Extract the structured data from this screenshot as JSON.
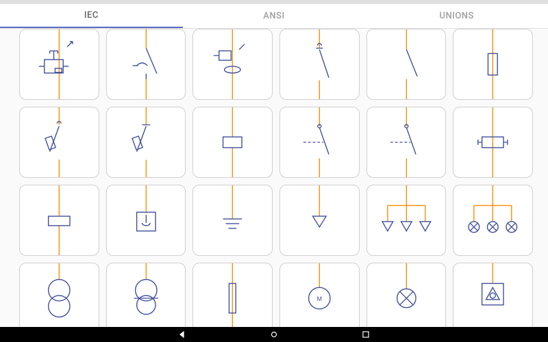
{
  "tabs": [
    {
      "label": "IEC",
      "active": true
    },
    {
      "label": "ANSI",
      "active": false
    },
    {
      "label": "UNIONS",
      "active": false
    }
  ],
  "symbols": {
    "r1": [
      {
        "name": "circuit-breaker-with-protection",
        "icon": "cb-protection"
      },
      {
        "name": "disconnector-switch-manual",
        "icon": "disc-manual"
      },
      {
        "name": "circuit-breaker-with-sensor",
        "icon": "cb-sensor"
      },
      {
        "name": "disconnector-switch",
        "icon": "disc"
      },
      {
        "name": "switch-break",
        "icon": "switch-break"
      },
      {
        "name": "fuse-rect",
        "icon": "fuse-rect"
      }
    ],
    "r2": [
      {
        "name": "fuse-switch-left",
        "icon": "fuse-switch-l"
      },
      {
        "name": "fuse-switch-right",
        "icon": "fuse-switch-r"
      },
      {
        "name": "inline-box",
        "icon": "inline-box"
      },
      {
        "name": "isolator-dashed",
        "icon": "isolator-dash"
      },
      {
        "name": "isolator-solid",
        "icon": "isolator-solid"
      },
      {
        "name": "fuse-with-contacts",
        "icon": "fuse-contacts"
      }
    ],
    "r3": [
      {
        "name": "relay-coil",
        "icon": "relay-coil"
      },
      {
        "name": "earth-box",
        "icon": "earth-box"
      },
      {
        "name": "earth-ground",
        "icon": "earth"
      },
      {
        "name": "arrow-down",
        "icon": "arrow-down"
      },
      {
        "name": "three-arrow-bus",
        "icon": "three-arrow"
      },
      {
        "name": "three-lamp-bus",
        "icon": "three-lamp"
      }
    ],
    "r4": [
      {
        "name": "transformer-two-winding",
        "icon": "xfmr2"
      },
      {
        "name": "transformer-auto",
        "icon": "xfmr-auto"
      },
      {
        "name": "fuse-long",
        "icon": "fuse-long"
      },
      {
        "name": "motor",
        "icon": "motor",
        "letter": "M"
      },
      {
        "name": "lamp",
        "icon": "lamp"
      },
      {
        "name": "delta-in-box",
        "icon": "delta-box"
      }
    ]
  },
  "motor_letter": "M"
}
